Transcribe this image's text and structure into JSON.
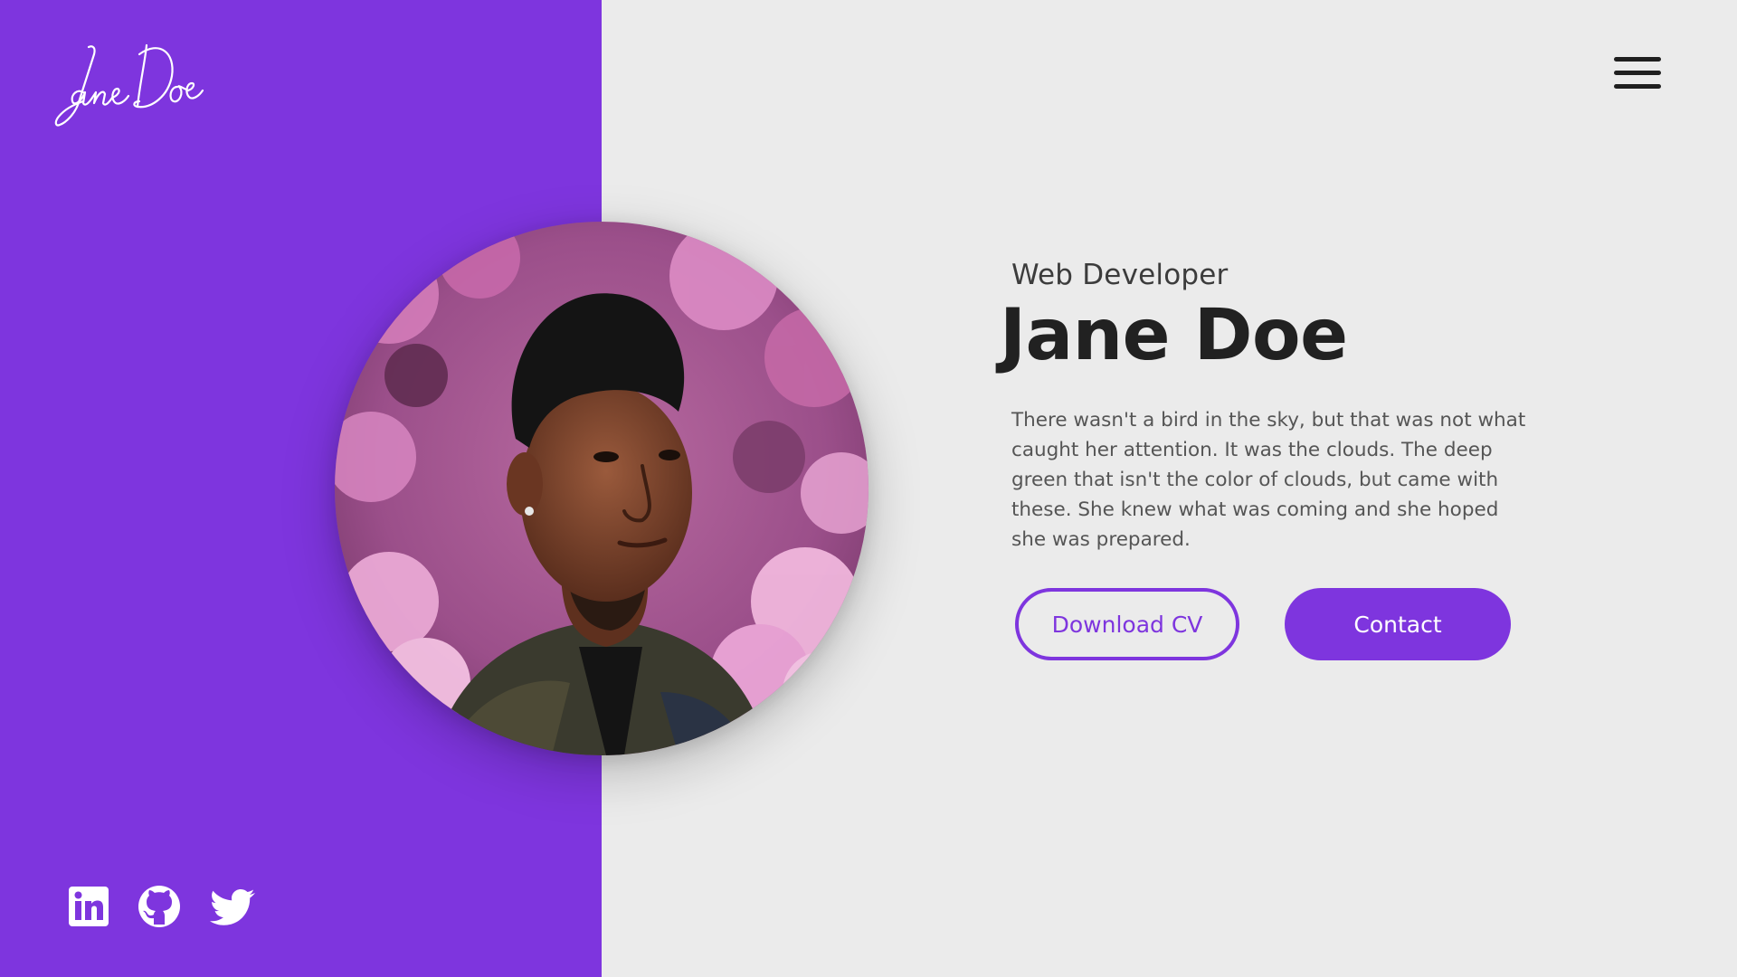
{
  "brand": {
    "logo_text": "Jane Doe",
    "logo_icon": "signature-logo"
  },
  "header": {
    "menu_icon": "hamburger-menu-icon"
  },
  "hero": {
    "role": "Web Developer",
    "name": "Jane Doe",
    "bio": "There wasn't a bird in the sky, but that was not what caught her attention. It was the clouds. The deep green that isn't the color of clouds, but came with these. She knew what was coming and she hoped she was prepared.",
    "download_label": "Download CV",
    "contact_label": "Contact"
  },
  "social": {
    "items": [
      {
        "icon": "linkedin-icon"
      },
      {
        "icon": "github-icon"
      },
      {
        "icon": "twitter-icon"
      }
    ]
  },
  "colors": {
    "accent": "#7e35de",
    "background": "#ebebeb",
    "heading": "#212121",
    "body_text": "#555555"
  }
}
